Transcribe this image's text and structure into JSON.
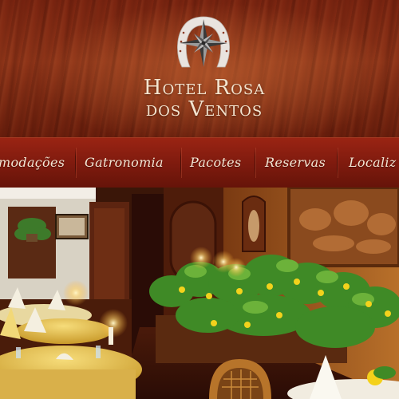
{
  "brand": {
    "line1": "Hotel Rosa",
    "line2": "dos Ventos",
    "logo_icon": "compass-rose-horseshoe-icon"
  },
  "nav": {
    "items": [
      {
        "label": "modações"
      },
      {
        "label": "Gatronomia"
      },
      {
        "label": "Pacotes"
      },
      {
        "label": "Reservas"
      },
      {
        "label": "Localiz"
      }
    ]
  },
  "hero": {
    "subject": "restaurant-dining-room-photo"
  },
  "colors": {
    "header_wood": "#7a2410",
    "nav_bar": "#7d1a0e",
    "nav_text": "#f4e6d4",
    "logo_text": "#f3e4cf"
  }
}
